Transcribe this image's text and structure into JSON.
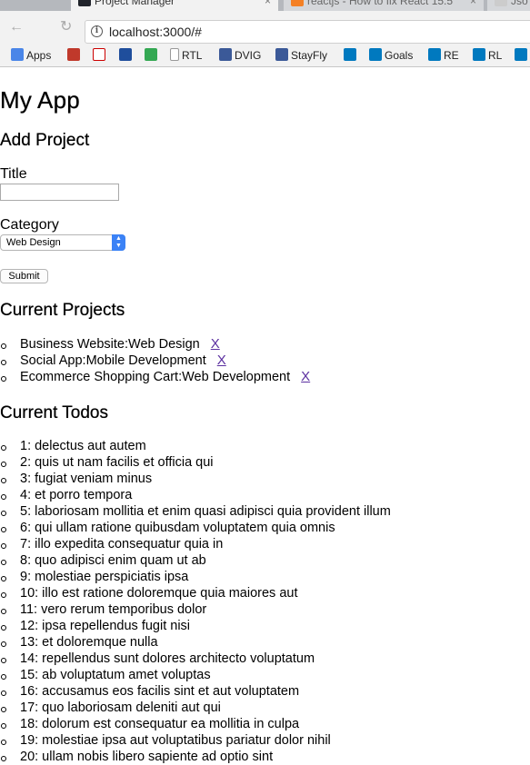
{
  "browser": {
    "tabs": [
      {
        "label": "Project Manager",
        "close": "×"
      },
      {
        "label": "reactjs - How to fix React 15.5",
        "close": "×"
      },
      {
        "label": "Jso"
      }
    ],
    "url": "localhost:3000/#",
    "bookmarks": [
      {
        "label": "Apps",
        "color": "#4a86e8"
      },
      {
        "label": "",
        "color": "#c0392b"
      },
      {
        "label": "",
        "color": "#cc0000"
      },
      {
        "label": "",
        "color": "#1f4e9c"
      },
      {
        "label": "",
        "color": "#34a853"
      },
      {
        "label": "RTL",
        "color": "#dddddd"
      },
      {
        "label": "DVIG",
        "color": "#3b5998"
      },
      {
        "label": "StayFly",
        "color": "#3b5998"
      },
      {
        "label": "",
        "color": "#0079bf"
      },
      {
        "label": "Goals",
        "color": "#0079bf"
      },
      {
        "label": "RE",
        "color": "#0079bf"
      },
      {
        "label": "RL",
        "color": "#0079bf"
      },
      {
        "label": "",
        "color": "#0079bf"
      }
    ]
  },
  "app": {
    "title": "My App",
    "add_heading": "Add Project",
    "title_label": "Title",
    "title_value": "",
    "category_label": "Category",
    "category_selected": "Web Design",
    "submit_label": "Submit",
    "projects_heading": "Current Projects",
    "projects": [
      {
        "title": "Business Website",
        "category": "Web Design",
        "delete": "X"
      },
      {
        "title": "Social App",
        "category": "Mobile Development",
        "delete": "X"
      },
      {
        "title": "Ecommerce Shopping Cart",
        "category": "Web Development",
        "delete": "X"
      }
    ],
    "todos_heading": "Current Todos",
    "todos": [
      "1: delectus aut autem",
      "2: quis ut nam facilis et officia qui",
      "3: fugiat veniam minus",
      "4: et porro tempora",
      "5: laboriosam mollitia et enim quasi adipisci quia provident illum",
      "6: qui ullam ratione quibusdam voluptatem quia omnis",
      "7: illo expedita consequatur quia in",
      "8: quo adipisci enim quam ut ab",
      "9: molestiae perspiciatis ipsa",
      "10: illo est ratione doloremque quia maiores aut",
      "11: vero rerum temporibus dolor",
      "12: ipsa repellendus fugit nisi",
      "13: et doloremque nulla",
      "14: repellendus sunt dolores architecto voluptatum",
      "15: ab voluptatum amet voluptas",
      "16: accusamus eos facilis sint et aut voluptatem",
      "17: quo laboriosam deleniti aut qui",
      "18: dolorum est consequatur ea mollitia in culpa",
      "19: molestiae ipsa aut voluptatibus pariatur dolor nihil",
      "20: ullam nobis libero sapiente ad optio sint"
    ]
  }
}
